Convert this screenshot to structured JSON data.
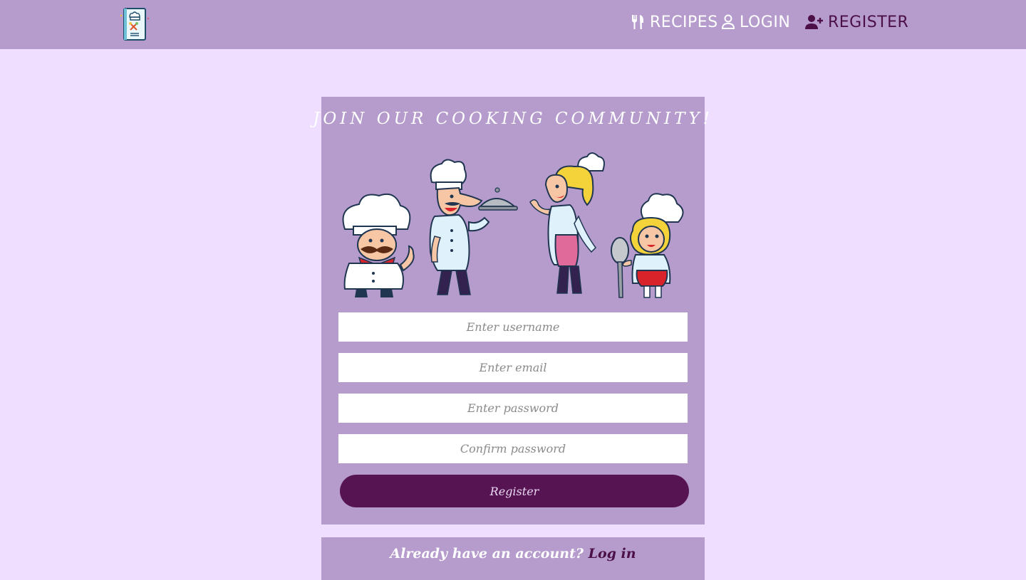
{
  "navbar": {
    "logo_icon": "recipe-book-logo",
    "items": [
      {
        "label": "RECIPES",
        "icon": "utensils-icon"
      },
      {
        "label": "LOGIN",
        "icon": "user-icon"
      },
      {
        "label": "REGISTER",
        "icon": "user-plus-icon"
      }
    ]
  },
  "register_form": {
    "title": "JOIN OUR COOKING COMMUNITY!",
    "illustration": "four-chefs-illustration",
    "username_placeholder": "Enter username",
    "email_placeholder": "Enter email",
    "password_placeholder": "Enter password",
    "confirm_placeholder": "Confirm password",
    "submit_label": "Register"
  },
  "login_prompt": {
    "text": "Already have an account?",
    "link_label": "Log in"
  },
  "colors": {
    "background": "#efdeff",
    "navbar": "#b59ccd",
    "card": "#b59ccd",
    "accent": "#561552",
    "active_nav": "#4c0f46"
  }
}
